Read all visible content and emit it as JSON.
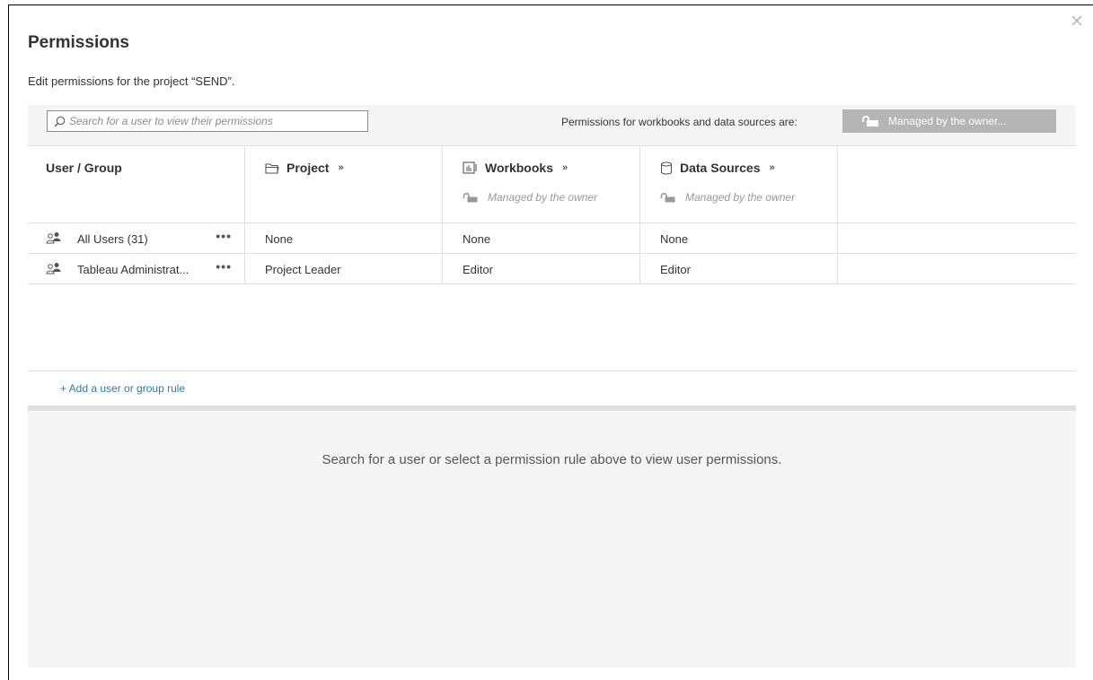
{
  "dialog": {
    "title": "Permissions",
    "subtitle": "Edit permissions for the project “SEND”."
  },
  "toolbar": {
    "search_placeholder": "Search for a user to view their permissions",
    "permissions_label": "Permissions for workbooks and data sources are:",
    "managed_button_label": "Managed by the owner..."
  },
  "grid": {
    "headers": [
      {
        "label": "User / Group",
        "sub": ""
      },
      {
        "label": "Project",
        "sub": ""
      },
      {
        "label": "Workbooks",
        "sub": "Managed by the owner"
      },
      {
        "label": "Data Sources",
        "sub": "Managed by the owner"
      }
    ],
    "expand_glyph": "»",
    "more_glyph": "•••",
    "rows": [
      {
        "user": "All Users (31)",
        "project": "None",
        "workbooks": "None",
        "datasources": "None"
      },
      {
        "user": "Tableau Administrat...",
        "project": "Project Leader",
        "workbooks": "Editor",
        "datasources": "Editor"
      }
    ]
  },
  "add_rule_label": "+ Add a user or group rule",
  "bottom_message": "Search for a user or select a permission rule above to view user permissions.",
  "colors": {
    "link": "#2e7aa8",
    "managed_button_bg": "#b5b5b5",
    "panel_bg": "#f5f5f5"
  },
  "icons": {
    "close": "close-icon",
    "search": "search-icon",
    "lock": "unlocked-lock-icon",
    "project": "folder-icon",
    "workbooks": "workbook-icon",
    "datasources": "database-icon",
    "user": "user-group-icon",
    "more": "more-icon"
  }
}
